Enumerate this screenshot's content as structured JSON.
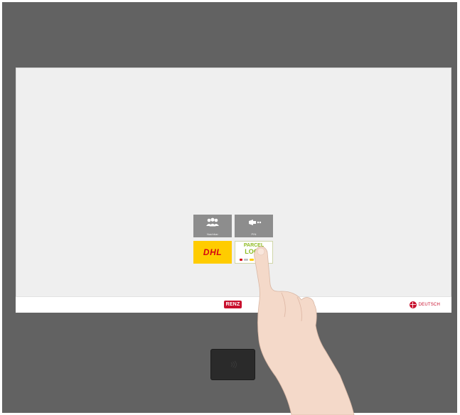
{
  "tiles": [
    {
      "label": "Nachbar",
      "icon": "people-icon"
    },
    {
      "label": "PIN",
      "icon": "pin-icon"
    },
    {
      "label": "DHL",
      "icon": "dhl-logo"
    },
    {
      "label": "PARCEL LOCK",
      "icon": "parcel-lock-logo"
    }
  ],
  "footer": {
    "brand": "RENZ",
    "language": "DEUTSCH"
  },
  "colors": {
    "housing": "#626262",
    "screen": "#efefef",
    "tile_grey": "#8d8d8d",
    "dhl_yellow": "#ffcc00",
    "dhl_red": "#d40511",
    "parcel_green": "#8dbb1f",
    "renz_red": "#c8102e"
  }
}
